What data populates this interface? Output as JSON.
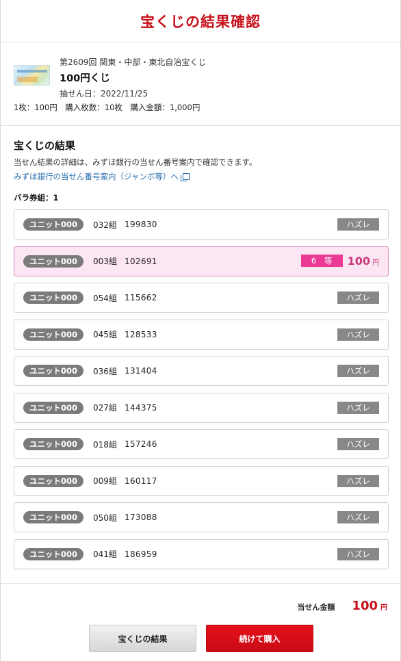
{
  "header": {
    "title": "宝くじの結果確認"
  },
  "lottery": {
    "draw_info": "第2609回 関東・中部・東北自治宝くじ",
    "name": "100円くじ",
    "draw_date": "抽せん日：2022/11/25",
    "purchase_info": "1枚：100円　購入枚数：10枚　購入金額：1,000円"
  },
  "results": {
    "title": "宝くじの結果",
    "description": "当せん結果の詳細は、みずほ銀行の当せん番号案内で確認できます。",
    "link_text": "みずほ銀行の当せん番号案内（ジャンボ等）へ",
    "bara_label": "バラ券組：1",
    "rows": [
      {
        "unit": "ユニット000",
        "group": "032組",
        "number": "199830",
        "result": "ハズレ"
      },
      {
        "unit": "ユニット000",
        "group": "003組",
        "number": "102691",
        "prize_rank": "6 等",
        "prize_amount": "100",
        "prize_unit": "円"
      },
      {
        "unit": "ユニット000",
        "group": "054組",
        "number": "115662",
        "result": "ハズレ"
      },
      {
        "unit": "ユニット000",
        "group": "045組",
        "number": "128533",
        "result": "ハズレ"
      },
      {
        "unit": "ユニット000",
        "group": "036組",
        "number": "131404",
        "result": "ハズレ"
      },
      {
        "unit": "ユニット000",
        "group": "027組",
        "number": "144375",
        "result": "ハズレ"
      },
      {
        "unit": "ユニット000",
        "group": "018組",
        "number": "157246",
        "result": "ハズレ"
      },
      {
        "unit": "ユニット000",
        "group": "009組",
        "number": "160117",
        "result": "ハズレ"
      },
      {
        "unit": "ユニット000",
        "group": "050組",
        "number": "173088",
        "result": "ハズレ"
      },
      {
        "unit": "ユニット000",
        "group": "041組",
        "number": "186959",
        "result": "ハズレ"
      }
    ]
  },
  "footer": {
    "total_label": "当せん金額",
    "total_amount": "100",
    "total_unit": "円",
    "btn_results": "宝くじの結果",
    "btn_continue": "続けて購入"
  },
  "colors": {
    "brand_red": "#c8101a",
    "win_pink": "#ea3a94",
    "win_bg": "#fde6f3",
    "lose_gray": "#888888",
    "link_blue": "#2a6fae"
  }
}
